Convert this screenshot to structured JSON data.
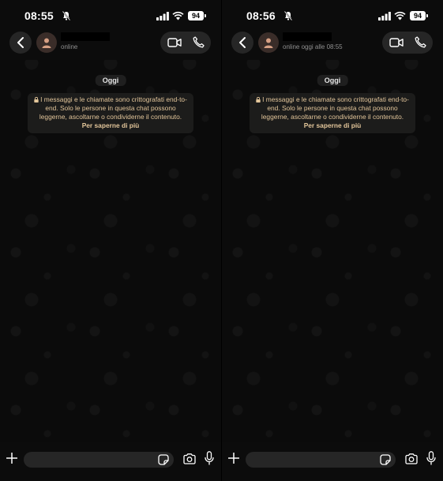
{
  "screens": [
    {
      "status": {
        "time": "08:55",
        "battery": "94"
      },
      "contact": {
        "presence": "online"
      },
      "chat": {
        "date_label": "Oggi",
        "encryption_notice": "I messaggi e le chiamate sono crittografati end-to-end. Solo le persone in questa chat possono leggerne, ascoltarne o condividerne il contenuto.",
        "learn_more": "Per saperne di più"
      }
    },
    {
      "status": {
        "time": "08:56",
        "battery": "94"
      },
      "contact": {
        "presence": "online oggi alle 08:55"
      },
      "chat": {
        "date_label": "Oggi",
        "encryption_notice": "I messaggi e le chiamate sono crittografati end-to-end. Solo le persone in questa chat possono leggerne, ascoltarne o condividerne il contenuto.",
        "learn_more": "Per saperne di più"
      }
    }
  ],
  "icons": {
    "silent": "bell-slash-icon",
    "signal": "cellular-signal-icon",
    "wifi": "wifi-icon",
    "back": "chevron-left-icon",
    "avatar": "person-icon",
    "video": "video-camera-icon",
    "call": "phone-icon",
    "lock": "lock-icon",
    "attach": "plus-icon",
    "sticker": "sticker-icon",
    "camera": "camera-icon",
    "mic": "microphone-icon"
  },
  "colors": {
    "notice_text": "#e2c59a",
    "avatar_bg": "#3a2d29",
    "avatar_icon": "#d7a084"
  }
}
